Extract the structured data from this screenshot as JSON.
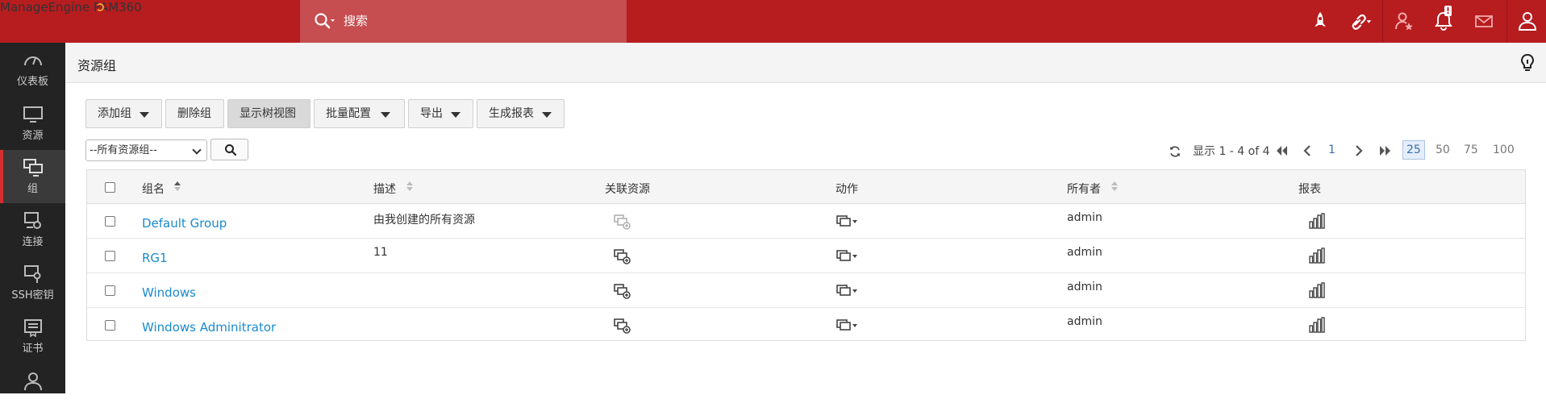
{
  "header": {
    "brand_small": "ManageEngine",
    "brand_large": "PAM360",
    "search_placeholder": "搜索",
    "notification_badge": "!"
  },
  "sidebar": {
    "items": [
      {
        "label": "仪表板",
        "icon": "dashboard-icon"
      },
      {
        "label": "资源",
        "icon": "monitor-icon"
      },
      {
        "label": "组",
        "icon": "group-icon",
        "active": true
      },
      {
        "label": "连接",
        "icon": "connection-icon"
      },
      {
        "label": "SSH密钥",
        "icon": "ssh-key-icon"
      },
      {
        "label": "证书",
        "icon": "certificate-icon"
      },
      {
        "label": "",
        "icon": "user-icon"
      }
    ]
  },
  "page": {
    "title": "资源组"
  },
  "toolbar": {
    "add_group": "添加组",
    "delete_group": "删除组",
    "tree_view": "显示树视图",
    "bulk_config": "批量配置",
    "export": "导出",
    "generate_report": "生成报表"
  },
  "filter": {
    "selected": "--所有资源组--"
  },
  "pagination": {
    "summary": "显示 1 - 4 of 4",
    "current_page": "1",
    "page_sizes": [
      "25",
      "50",
      "75",
      "100"
    ],
    "active_size": "25"
  },
  "table": {
    "columns": {
      "name": "组名",
      "description": "描述",
      "associated": "关联资源",
      "action": "动作",
      "owner": "所有者",
      "report": "报表"
    },
    "rows": [
      {
        "name": "Default Group",
        "description": "由我创建的所有资源",
        "owner": "admin"
      },
      {
        "name": "RG1",
        "description": "11",
        "owner": "admin"
      },
      {
        "name": "Windows",
        "description": "",
        "owner": "admin"
      },
      {
        "name": "Windows Adminitrator",
        "description": "",
        "owner": "admin"
      }
    ]
  },
  "colors": {
    "header_red": "#b71c1f",
    "sidebar_dark": "#232323",
    "link_blue": "#1a8ad0"
  }
}
